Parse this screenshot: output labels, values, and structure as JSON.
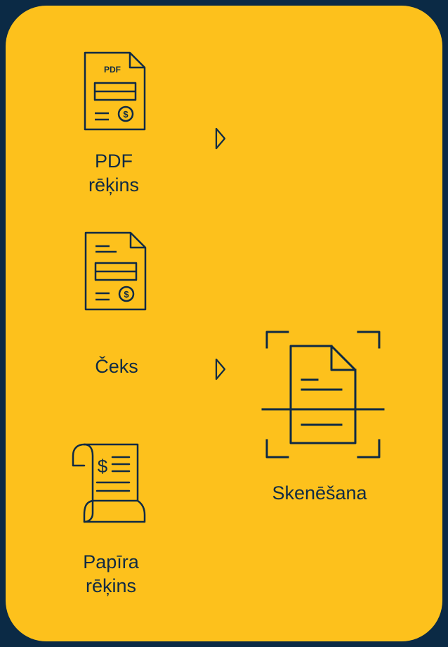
{
  "colors": {
    "background": "#0b2a45",
    "card": "#fdc11c",
    "ink": "#0f2a44"
  },
  "items": [
    {
      "label": "PDF\nrēķins",
      "icon": "pdf-invoice-icon",
      "badge": "PDF"
    },
    {
      "label": "Čeks",
      "icon": "receipt-document-icon"
    },
    {
      "label": "Papīra\nrēķins",
      "icon": "paper-scroll-invoice-icon",
      "currency": "$"
    }
  ],
  "result": {
    "label": "Skenēšana",
    "icon": "scan-document-icon"
  },
  "arrows": [
    "play-arrow-icon",
    "play-arrow-icon"
  ]
}
